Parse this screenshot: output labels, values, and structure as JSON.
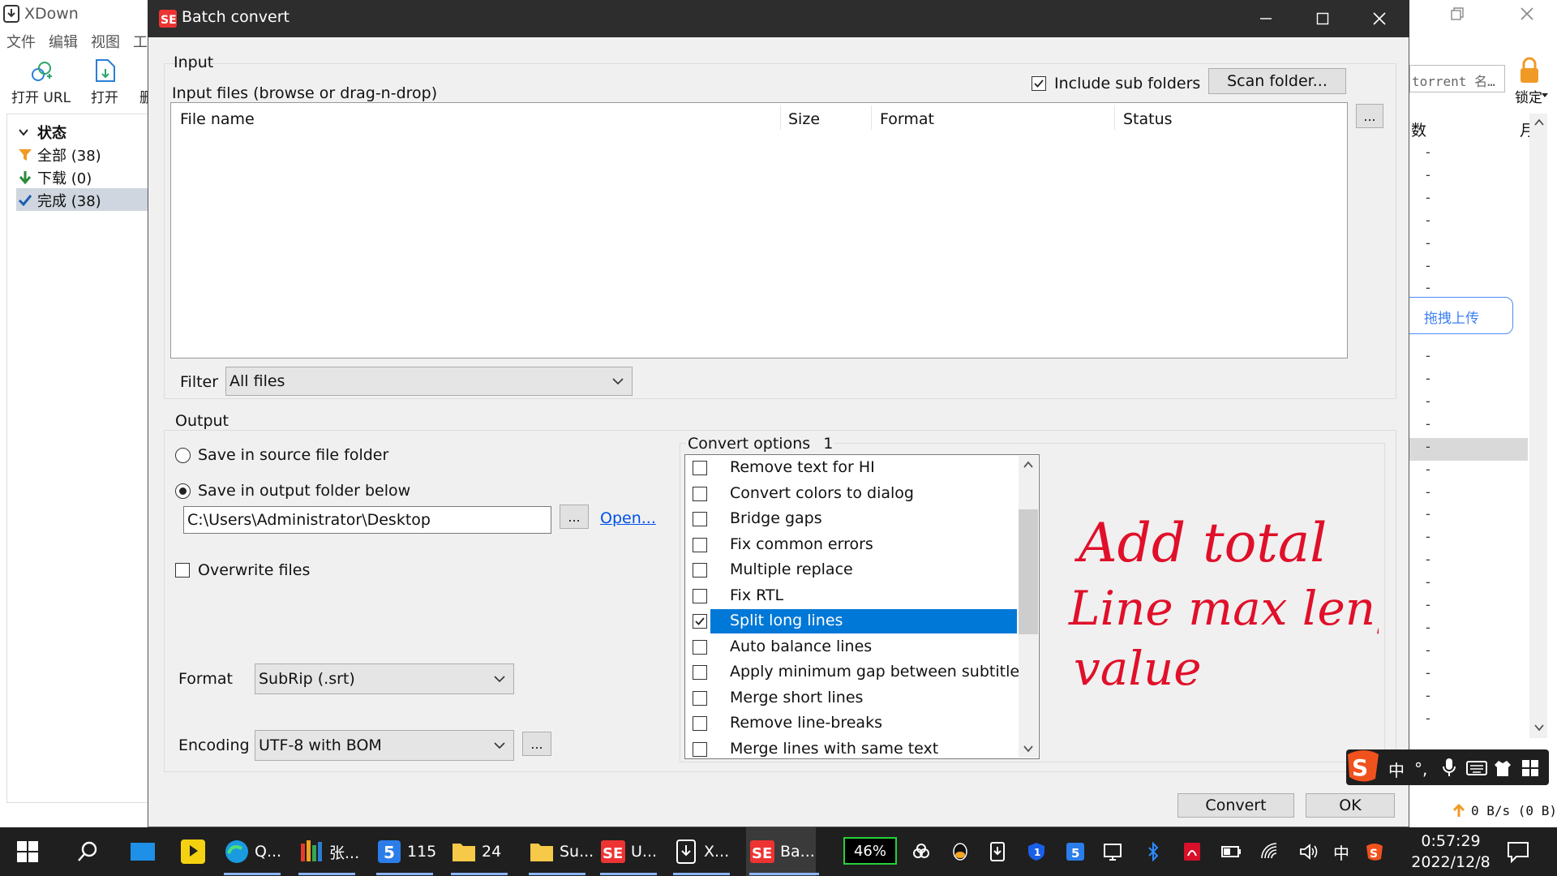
{
  "bg_app": {
    "title": "XDown",
    "menu": [
      "文件",
      "编辑",
      "视图",
      "工"
    ],
    "toolbar": {
      "open_url": "打开 URL",
      "open": "打开",
      "third": "删"
    },
    "sidebar": {
      "header": "状态",
      "items": [
        {
          "label": "全部 (38)",
          "icon": "filter-icon"
        },
        {
          "label": "下载 (0)",
          "icon": "download-arrow-icon"
        },
        {
          "label": "完成 (38)",
          "icon": "check-icon"
        }
      ]
    },
    "search_placeholder": "torrent 名…",
    "lock_label": "锁定",
    "right_col1": "数",
    "right_col2": "月",
    "dash": "-",
    "upload_label": "拖拽上传",
    "speed": "0 B/s (0 B)"
  },
  "dialog": {
    "title": "Batch convert",
    "input": {
      "group_label": "Input",
      "files_label": "Input files (browse or drag-n-drop)",
      "include_sub": "Include sub folders",
      "include_sub_checked": true,
      "scan_folder": "Scan folder...",
      "browse": "...",
      "columns": [
        "File name",
        "Size",
        "Format",
        "Status"
      ],
      "filter_label": "Filter",
      "filter_value": "All files"
    },
    "output": {
      "group_label": "Output",
      "save_source": "Save in source file folder",
      "save_output": "Save in output folder below",
      "selected": "output",
      "folder": "C:\\Users\\Administrator\\Desktop",
      "browse": "...",
      "open_link": "Open...",
      "overwrite": "Overwrite files",
      "format_label": "Format",
      "format_value": "SubRip (.srt)",
      "encoding_label": "Encoding",
      "encoding_value": "UTF-8 with BOM",
      "encoding_browse": "..."
    },
    "convert_options": {
      "label": "Convert options",
      "count": "1",
      "items": [
        {
          "label": "Remove text for HI",
          "checked": false
        },
        {
          "label": "Convert colors to dialog",
          "checked": false
        },
        {
          "label": "Bridge gaps",
          "checked": false
        },
        {
          "label": "Fix common errors",
          "checked": false
        },
        {
          "label": "Multiple replace",
          "checked": false
        },
        {
          "label": "Fix RTL",
          "checked": false
        },
        {
          "label": "Split long lines",
          "checked": true,
          "selected": true
        },
        {
          "label": "Auto balance lines",
          "checked": false
        },
        {
          "label": "Apply minimum gap between subtitles",
          "checked": false
        },
        {
          "label": "Merge short lines",
          "checked": false
        },
        {
          "label": "Remove line-breaks",
          "checked": false
        },
        {
          "label": "Merge lines with same text",
          "checked": false
        }
      ]
    },
    "annotation": [
      "Add total",
      "Line max length",
      "value"
    ],
    "buttons": {
      "convert": "Convert",
      "ok": "OK"
    }
  },
  "taskbar": {
    "items": [
      {
        "label": "Q...",
        "icon": "edge-icon"
      },
      {
        "label": "张...",
        "icon": "app-icon"
      },
      {
        "label": "115",
        "icon": "115-icon"
      },
      {
        "label": "24",
        "icon": "folder-icon"
      },
      {
        "label": "Su...",
        "icon": "folder-icon"
      },
      {
        "label": "U...",
        "icon": "subtitle-edit-icon"
      },
      {
        "label": "X...",
        "icon": "xdown-icon"
      },
      {
        "label": "Ba...",
        "icon": "subtitle-edit-icon"
      }
    ],
    "battery": "46%",
    "ime": "中",
    "time": "0:57:29",
    "date": "2022/12/8"
  },
  "colors": {
    "selection": "#0078d7",
    "annotation": "#e0102a",
    "titlebar": "#2d2d2d",
    "taskbar": "#1f1f1f"
  }
}
